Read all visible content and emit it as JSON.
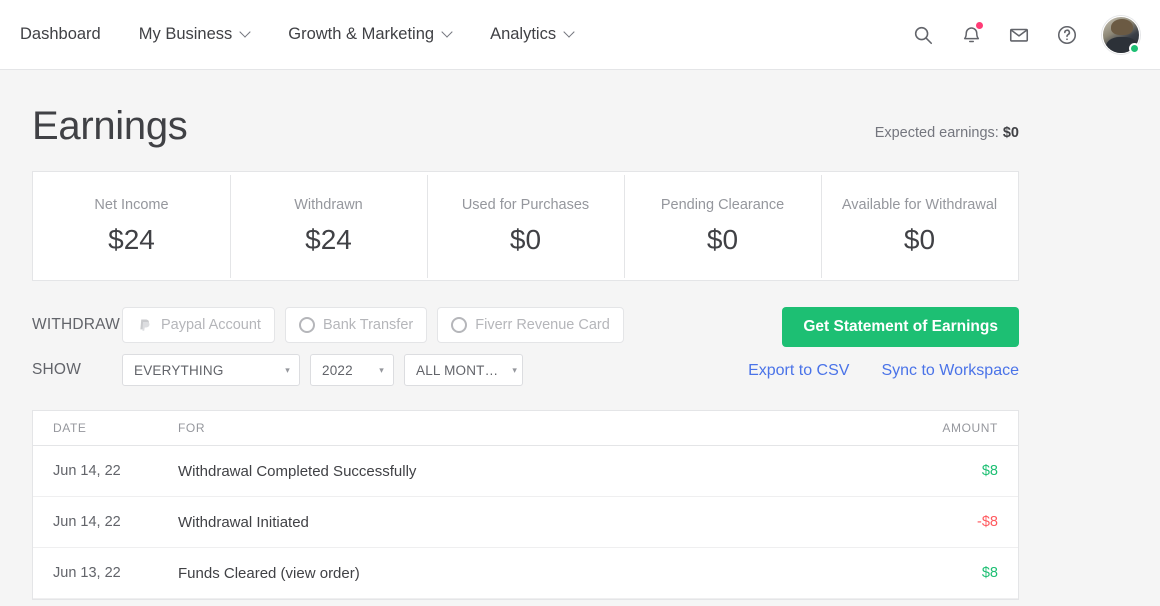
{
  "nav": {
    "items": [
      {
        "label": "Dashboard",
        "has_caret": false
      },
      {
        "label": "My Business",
        "has_caret": true
      },
      {
        "label": "Growth & Marketing",
        "has_caret": true
      },
      {
        "label": "Analytics",
        "has_caret": true
      }
    ],
    "icons": [
      {
        "name": "search-icon"
      },
      {
        "name": "bell-icon",
        "badge": true
      },
      {
        "name": "envelope-icon"
      },
      {
        "name": "help-circle-icon"
      }
    ],
    "avatar": {
      "name": "avatar",
      "online": true
    }
  },
  "header": {
    "title": "Earnings",
    "expected_label": "Expected earnings:",
    "expected_value": "$0"
  },
  "stats": [
    {
      "label": "Net Income",
      "value": "$24"
    },
    {
      "label": "Withdrawn",
      "value": "$24"
    },
    {
      "label": "Used for Purchases",
      "value": "$0"
    },
    {
      "label": "Pending Clearance",
      "value": "$0"
    },
    {
      "label": "Available for Withdrawal",
      "value": "$0"
    }
  ],
  "withdraw": {
    "label": "WITHDRAW",
    "options": [
      {
        "label": "Paypal Account",
        "icon": "paypal-icon",
        "selected": false
      },
      {
        "label": "Bank Transfer",
        "icon": "radio-circle-icon",
        "selected": false
      },
      {
        "label": "Fiverr Revenue Card",
        "icon": "radio-circle-icon",
        "selected": false
      }
    ]
  },
  "show": {
    "label": "SHOW",
    "filters": [
      {
        "name": "type",
        "value": "EVERYTHING",
        "caret": "▾"
      },
      {
        "name": "year",
        "value": "2022",
        "caret": "▾"
      },
      {
        "name": "month",
        "value": "ALL MONT…",
        "caret": "▾"
      }
    ]
  },
  "actions": {
    "statement_button": "Get Statement of Earnings",
    "links": [
      {
        "label": "Export to CSV"
      },
      {
        "label": "Sync to Workspace"
      }
    ]
  },
  "table": {
    "columns": {
      "date": "DATE",
      "for": "FOR",
      "amount": "AMOUNT"
    },
    "rows": [
      {
        "date": "Jun 14, 22",
        "for": "Withdrawal Completed Successfully",
        "amount": "$8",
        "sign": "pos"
      },
      {
        "date": "Jun 14, 22",
        "for": "Withdrawal Initiated",
        "amount": "-$8",
        "sign": "neg"
      },
      {
        "date": "Jun 13, 22",
        "for": "Funds Cleared (view order)",
        "amount": "$8",
        "sign": "pos"
      }
    ]
  },
  "colors": {
    "brand_green": "#1dbf73",
    "link_blue": "#4a73e8",
    "negative_red": "#ff5a5f",
    "page_bg": "#f5f5f5",
    "border": "#e4e5e7",
    "text": "#404145",
    "muted": "#95979d",
    "badge_pink": "#ff3c76"
  }
}
